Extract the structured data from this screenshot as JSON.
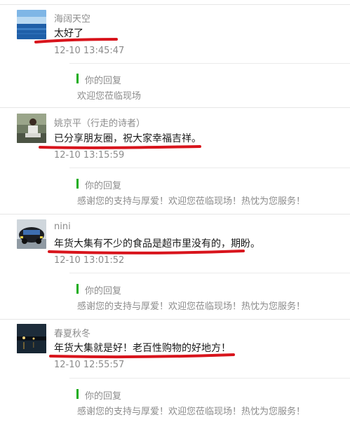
{
  "comments": [
    {
      "nickname": "海阔天空",
      "text": "太好了",
      "time": "12-10 13:45:47",
      "avatar": "sea-sky-avatar",
      "reply_label": "你的回复",
      "reply_text": "欢迎您莅临现场"
    },
    {
      "nickname": "姚京平（行走的诗者）",
      "text": "已分享朋友圈，祝大家幸福吉祥。",
      "time": "12-10 13:15:59",
      "avatar": "person-seated-avatar",
      "reply_label": "你的回复",
      "reply_text": "感谢您的支持与厚爱！欢迎您莅临现场！热忱为您服务！"
    },
    {
      "nickname": "nini",
      "text": "年货大集有不少的食品是超市里没有的，期盼。",
      "time": "12-10 13:01:52",
      "avatar": "car-avatar",
      "reply_label": "你的回复",
      "reply_text": "感谢您的支持与厚爱！欢迎您莅临现场！热忱为您服务！"
    },
    {
      "nickname": "春夏秋冬",
      "text": "年货大集就是好！老百性购物的好地方！",
      "time": "12-10 12:55:57",
      "avatar": "night-lake-avatar",
      "reply_label": "你的回复",
      "reply_text": "感谢您的支持与厚爱！欢迎您莅临现场！热忱为您服务！"
    }
  ],
  "colors": {
    "reply_bar": "#1aad19",
    "annotation_underline": "#d8141c",
    "meta_text": "#8c8c8c"
  }
}
